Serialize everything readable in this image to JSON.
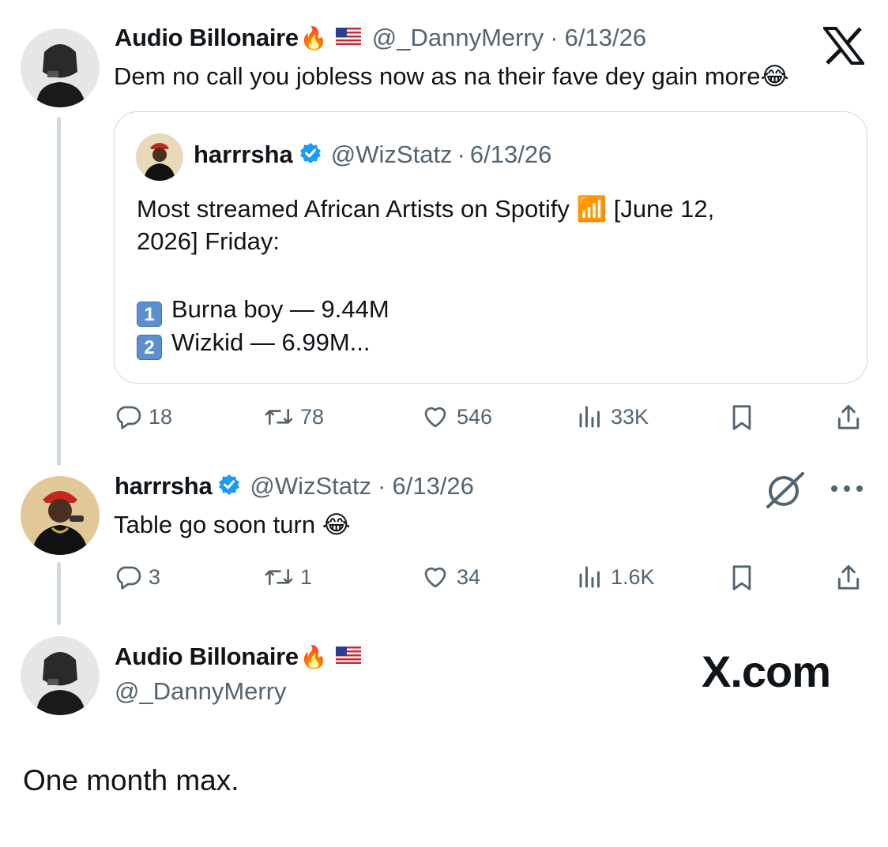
{
  "thread": {
    "tweet1": {
      "author_name": "Audio Billonaire",
      "author_emoji": "🔥",
      "handle": "@_DannyMerry",
      "separator": "·",
      "date": "6/13/26",
      "text": "Dem no call you jobless now as na their fave dey gain more😂",
      "quote": {
        "author_name": "harrrsha",
        "handle": "@WizStatz",
        "separator": "·",
        "date": "6/13/26",
        "line1": "Most streamed African Artists on Spotify 📶 [June 12,",
        "line2": "2026] Friday:",
        "item1_key": "1",
        "item1_text": "Burna boy — 9.44M",
        "item2_key": "2",
        "item2_text": "Wizkid — 6.99M..."
      },
      "actions": {
        "replies": "18",
        "reposts": "78",
        "likes": "546",
        "views": "33K"
      }
    },
    "tweet2": {
      "author_name": "harrrsha",
      "handle": "@WizStatz",
      "separator": "·",
      "date": "6/13/26",
      "text": "Table go soon turn 😂",
      "actions": {
        "replies": "3",
        "reposts": "1",
        "likes": "34",
        "views": "1.6K"
      }
    },
    "tweet3": {
      "author_name": "Audio Billonaire",
      "author_emoji": "🔥",
      "handle": "@_DannyMerry",
      "text": "One month max."
    }
  },
  "watermark": {
    "text": "X.com"
  },
  "icons": [
    "x-logo-icon",
    "reply-icon",
    "repost-icon",
    "like-icon",
    "views-icon",
    "bookmark-icon",
    "share-icon",
    "verified-badge-icon",
    "grok-icon",
    "more-icon",
    "us-flag-icon"
  ],
  "colors": {
    "text": "#0f1419",
    "secondary": "#536471",
    "border": "#cfd9de",
    "verified": "#1d9bf0"
  }
}
